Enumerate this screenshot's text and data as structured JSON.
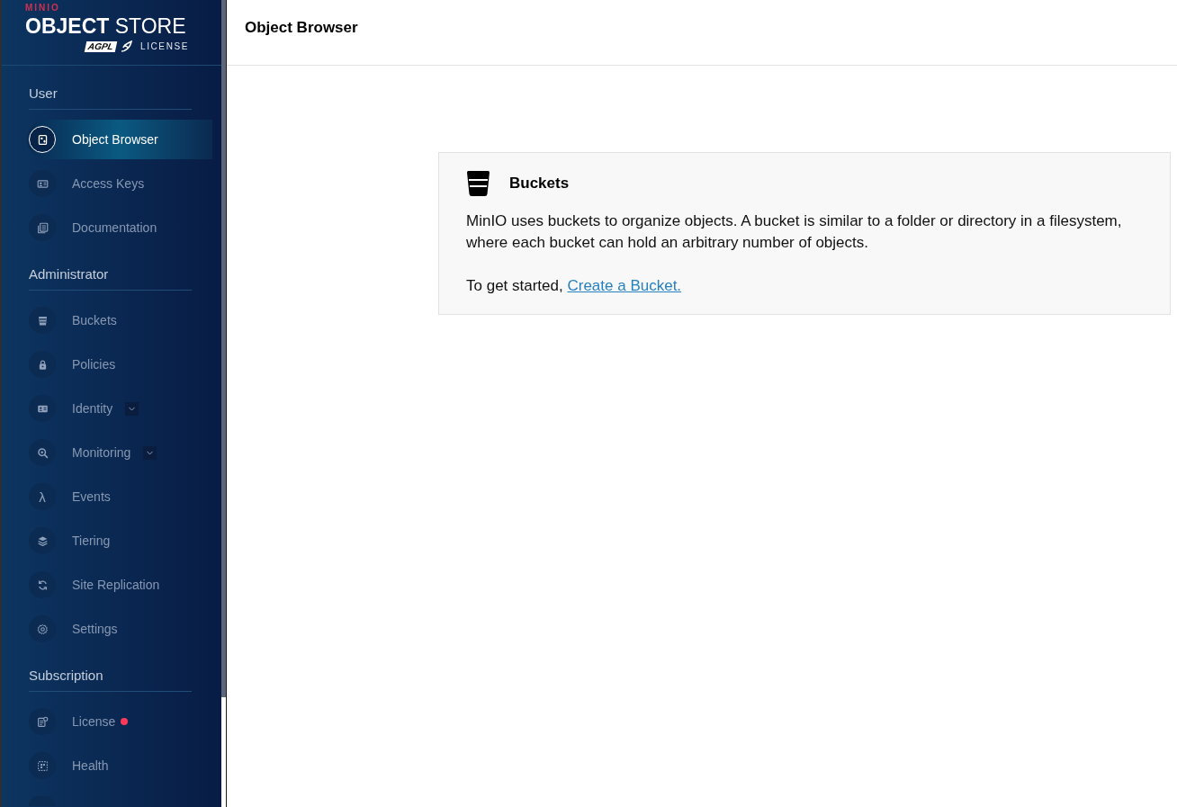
{
  "logo": {
    "brand": "MINIO",
    "product": "**OBJECT** STORE",
    "license_badge": "AGPL",
    "license_label": "LICENSE"
  },
  "sidebar": {
    "sections": [
      {
        "title": "User",
        "items": [
          {
            "label": "Object Browser",
            "kind": "link",
            "selected": true,
            "alert": false
          },
          {
            "label": "Access Keys",
            "kind": "link",
            "selected": false,
            "alert": false
          },
          {
            "label": "Documentation",
            "kind": "link",
            "selected": false,
            "alert": false
          }
        ]
      },
      {
        "title": "Administrator",
        "items": [
          {
            "label": "Buckets",
            "kind": "link",
            "selected": false,
            "alert": false
          },
          {
            "label": "Policies",
            "kind": "link",
            "selected": false,
            "alert": false
          },
          {
            "label": "Identity",
            "kind": "group",
            "expanded": false,
            "selected": false,
            "alert": false
          },
          {
            "label": "Monitoring",
            "kind": "group",
            "expanded": false,
            "selected": false,
            "alert": false
          },
          {
            "label": "Events",
            "kind": "link",
            "icon_text": "λ",
            "selected": false,
            "alert": false
          },
          {
            "label": "Tiering",
            "kind": "link",
            "selected": false,
            "alert": false
          },
          {
            "label": "Site Replication",
            "kind": "link",
            "selected": false,
            "alert": false
          },
          {
            "label": "Settings",
            "kind": "link",
            "selected": false,
            "alert": false
          }
        ]
      },
      {
        "title": "Subscription",
        "items": [
          {
            "label": "License",
            "kind": "link",
            "selected": false,
            "alert": true
          },
          {
            "label": "Health",
            "kind": "link",
            "selected": false,
            "alert": false
          }
        ]
      }
    ]
  },
  "header": {
    "title": "Object Browser"
  },
  "card": {
    "title": "Buckets",
    "description": "MinIO uses buckets to organize objects. A bucket is similar to a folder or directory in a filesystem, where each bucket can hold an arbitrary number of objects.",
    "prompt": "To get started,",
    "link": "Create a Bucket."
  }
}
